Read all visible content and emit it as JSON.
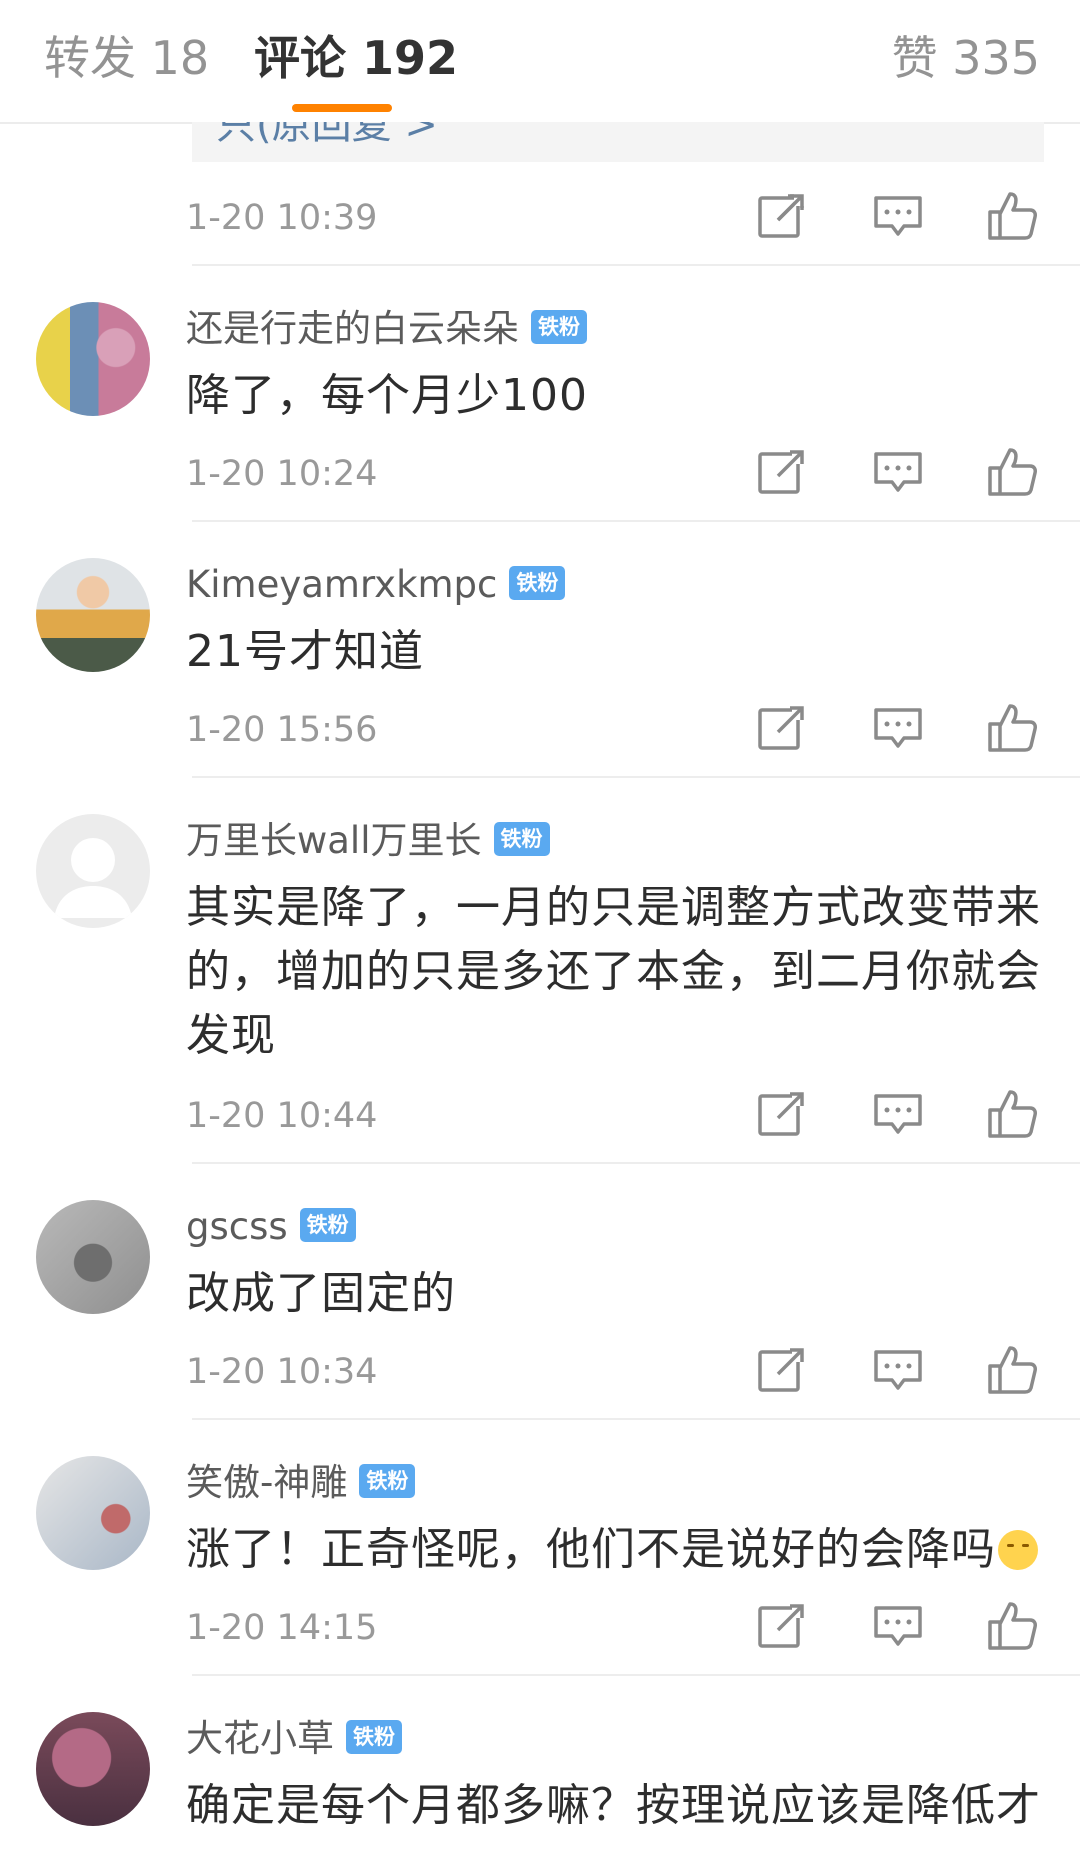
{
  "tabs": {
    "repost": "转发 18",
    "comments": "评论 192",
    "likes": "赞 335",
    "accent_color": "#ff8200"
  },
  "quote": {
    "text": "只(原回复 >"
  },
  "first_time": "1-20 10:39",
  "badge_label": "铁粉",
  "comments": [
    {
      "user": "还是行走的白云朵朵",
      "text": "降了，每个月少100",
      "time": "1-20 10:24"
    },
    {
      "user": "Kimeyamrxkmpc",
      "text": "21号才知道",
      "time": "1-20 15:56"
    },
    {
      "user": "万里长wall万里长",
      "text": "其实是降了，一月的只是调整方式改变带来的，增加的只是多还了本金，到二月你就会发现",
      "time": "1-20 10:44"
    },
    {
      "user": "gscss",
      "text": "改成了固定的",
      "time": "1-20 10:34"
    },
    {
      "user": "笑傲-神雕",
      "text": "涨了！正奇怪呢，他们不是说好的会降吗",
      "time": "1-20 14:15"
    },
    {
      "user": "大花小草",
      "text": "确定是每个月都多嘛？按理说应该是降低才"
    }
  ],
  "icons": {
    "share": "share-icon",
    "comment": "comment-icon",
    "like": "like-icon",
    "badge": "iron-fan-badge",
    "emoji": "shushing-face-emoji"
  }
}
